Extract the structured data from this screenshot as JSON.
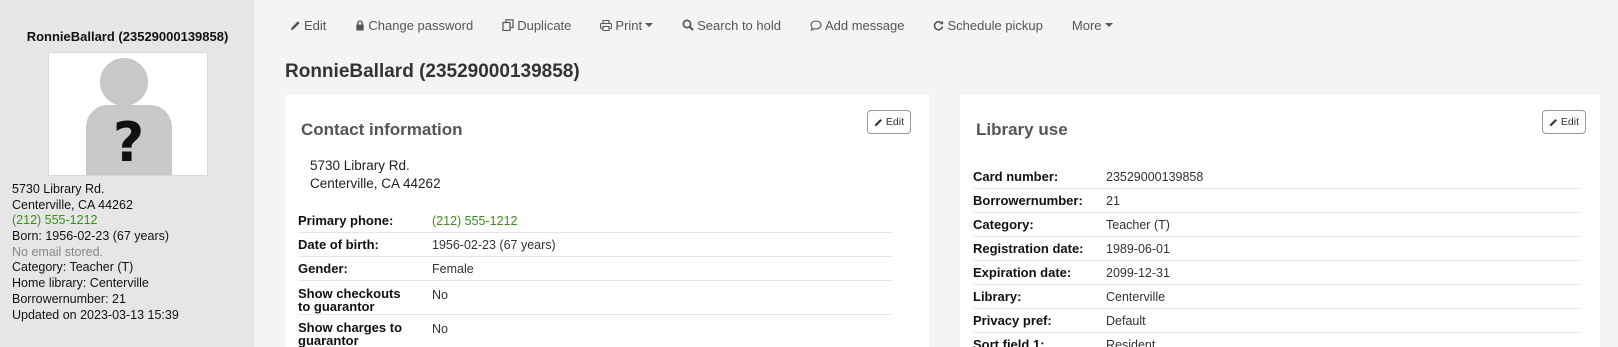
{
  "patron": {
    "display_name": "RonnieBallard (23529000139858)"
  },
  "sidebar": {
    "address_line1": "5730 Library Rd.",
    "address_line2": "Centerville, CA 44262",
    "phone": "(212) 555-1212",
    "born": "Born: 1956-02-23 (67 years)",
    "email_status": "No email stored.",
    "category": "Category: Teacher (T)",
    "home_library": "Home library: Centerville",
    "borrowernumber": "Borrowernumber: 21",
    "updated": "Updated on 2023-03-13 15:39",
    "photo_placeholder": "?"
  },
  "toolbar": {
    "edit": "Edit",
    "change_password": "Change password",
    "duplicate": "Duplicate",
    "print": "Print",
    "search_to_hold": "Search to hold",
    "add_message": "Add message",
    "schedule_pickup": "Schedule pickup",
    "more": "More"
  },
  "contact": {
    "title": "Contact information",
    "edit_label": "Edit",
    "address_line1": "5730 Library Rd.",
    "address_line2": "Centerville, CA 44262",
    "rows": [
      {
        "label": "Primary phone:",
        "value": "(212) 555-1212"
      },
      {
        "label": "Date of birth:",
        "value": "1956-02-23 (67 years)"
      },
      {
        "label": "Gender:",
        "value": "Female"
      },
      {
        "label_line1": "Show checkouts",
        "label_line2": "to guarantor",
        "value": "No"
      },
      {
        "label_line1": "Show charges to",
        "label_line2": "guarantor",
        "value": "No"
      }
    ]
  },
  "library_use": {
    "title": "Library use",
    "edit_label": "Edit",
    "rows": [
      {
        "label": "Card number:",
        "value": "23529000139858"
      },
      {
        "label": "Borrowernumber:",
        "value": "21"
      },
      {
        "label": "Category:",
        "value": "Teacher (T)"
      },
      {
        "label": "Registration date:",
        "value": "1989-06-01"
      },
      {
        "label": "Expiration date:",
        "value": "2099-12-31"
      },
      {
        "label": "Library:",
        "value": "Centerville"
      },
      {
        "label": "Privacy pref:",
        "value": "Default"
      },
      {
        "label": "Sort field 1:",
        "value": "Resident"
      }
    ]
  },
  "colors": {
    "phone_green": "#3a8f1a",
    "sidebar_bg": "#e6e6e6",
    "page_bg": "#f4f4f2"
  },
  "icons": {
    "edit": "pencil-icon",
    "change_password": "lock-icon",
    "duplicate": "copy-icon",
    "print": "printer-icon",
    "search_to_hold": "search-icon",
    "add_message": "comment-icon",
    "schedule_pickup": "refresh-icon"
  }
}
